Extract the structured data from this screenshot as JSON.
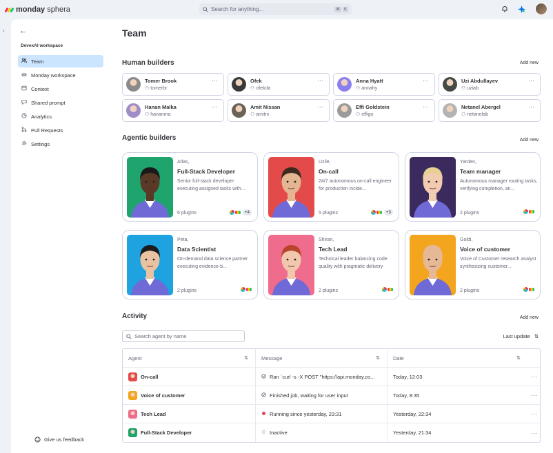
{
  "app": {
    "name_bold": "monday",
    "name_light": "sphera",
    "search_placeholder": "Search for anything...",
    "shortcut": [
      "⌘",
      "K"
    ]
  },
  "sidebar": {
    "workspace": "DevexAI workspace",
    "items": [
      {
        "label": "Team",
        "icon": "people-icon",
        "active": true
      },
      {
        "label": "Monday workspace",
        "icon": "workspace-icon"
      },
      {
        "label": "Context",
        "icon": "context-icon"
      },
      {
        "label": "Shared prompt",
        "icon": "prompt-icon"
      },
      {
        "label": "Analytics",
        "icon": "analytics-icon"
      },
      {
        "label": "Pull Requests",
        "icon": "pull-request-icon"
      },
      {
        "label": "Settings",
        "icon": "gear-icon"
      }
    ],
    "feedback": "Give us feedback"
  },
  "page": {
    "title": "Team",
    "human_title": "Human builders",
    "agentic_title": "Agentic builders",
    "activity_title": "Activity",
    "add_new": "Add new"
  },
  "humans": [
    {
      "name": "Tomer Brook",
      "user": "tomerbr",
      "color": "#8a8a8a"
    },
    {
      "name": "Ofek",
      "user": "ofekda",
      "color": "#3a3a3a"
    },
    {
      "name": "Anna Hyatt",
      "user": "annahy",
      "color": "#8b7ff0"
    },
    {
      "name": "Uzi Abdullayev",
      "user": "uziab",
      "color": "#444a44"
    },
    {
      "name": "Hanan Malka",
      "user": "hananma",
      "color": "#a08cc8"
    },
    {
      "name": "Amit Nissan",
      "user": "amitni",
      "color": "#6b6357"
    },
    {
      "name": "Effi Goldstein",
      "user": "effigo",
      "color": "#9a9a9a"
    },
    {
      "name": "Netanel Abergel",
      "user": "netanelab",
      "color": "#b3b3b3"
    }
  ],
  "agents": [
    {
      "nick": "Atlas,",
      "role": "Full-Stack Developer",
      "desc": "Senior full-stack developer executing assigned tasks with...",
      "plugins": "6 plugins",
      "extra": "+4",
      "bg": "#1fa46d",
      "skin": "#5a3a26",
      "hair": "#1a1a1a"
    },
    {
      "nick": "Uzile,",
      "role": "On-call",
      "desc": "24/7 autonomous on-call engineer for production incide...",
      "plugins": "5 plugins",
      "extra": "+3",
      "bg": "#e34b4b",
      "skin": "#e3b592",
      "hair": "#3b2a1d"
    },
    {
      "nick": "Yarden,",
      "role": "Team manager",
      "desc": "Autonomous manager routing tasks, verifying completion, an...",
      "plugins": "2 plugins",
      "extra": "",
      "bg": "#3a2a5e",
      "skin": "#f1ccb0",
      "hair": "#e8cf92"
    },
    {
      "nick": "Peta,",
      "role": "Data Scientist",
      "desc": "On-demand data science partner executing evidence-b...",
      "plugins": "2 plugins",
      "extra": "",
      "bg": "#1ea2e0",
      "skin": "#e9c3a1",
      "hair": "#1b1b1b"
    },
    {
      "nick": "Shiran,",
      "role": "Tech Lead",
      "desc": "Technical leader balancing code quality with pragmatic delivery",
      "plugins": "2 plugins",
      "extra": "",
      "bg": "#ef6c8c",
      "skin": "#f1c7ad",
      "hair": "#b8452a"
    },
    {
      "nick": "Goldi,",
      "role": "Voice of customer",
      "desc": "Voice of Customer research analyst synthesizing customer...",
      "plugins": "2 plugins",
      "extra": "",
      "bg": "#f2a51d",
      "skin": "#e6b896",
      "hair": "#e6b896"
    }
  ],
  "activity": {
    "search_placeholder": "Search agent by name",
    "last_update": "Last update",
    "columns": [
      "Agent",
      "Message",
      "Date"
    ],
    "rows": [
      {
        "agent": "On-call",
        "message": "Ran `curl -s -X POST \"https://api.monday.co...",
        "date": "Today, 12:03",
        "status": "done",
        "color": "#e34b4b"
      },
      {
        "agent": "Voice of customer",
        "message": "Finished job, waiting for user input",
        "date": "Today, 8:35",
        "status": "done",
        "color": "#f2a51d"
      },
      {
        "agent": "Tech Lead",
        "message": "Running since yesterday, 23:31",
        "date": "Yesterday, 22:34",
        "status": "running",
        "color": "#ef6c8c"
      },
      {
        "agent": "Full-Stack Developer",
        "message": "Inactive",
        "date": "Yesterday, 21:34",
        "status": "inactive",
        "color": "#1fa46d"
      }
    ]
  }
}
